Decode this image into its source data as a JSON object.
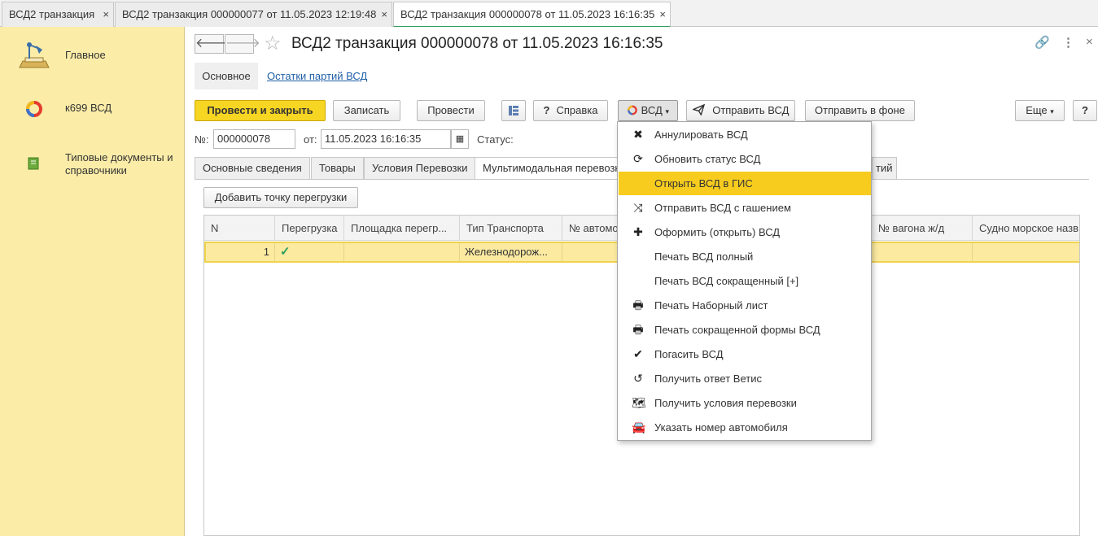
{
  "window_tabs": [
    {
      "label": "ВСД2 транзакция",
      "close": "×"
    },
    {
      "label": "ВСД2 транзакция 000000077 от 11.05.2023 12:19:48",
      "close": "×"
    },
    {
      "label": "ВСД2 транзакция 000000078 от 11.05.2023 16:16:35",
      "close": "×"
    }
  ],
  "sidebar": {
    "items": [
      {
        "label": "Главное",
        "icon": "desk-lamp-icon"
      },
      {
        "label": "к699 ВСД",
        "icon": "vetis-logo-icon"
      },
      {
        "label": "Типовые документы и справочники",
        "icon": "green-book-icon"
      }
    ]
  },
  "header": {
    "title": "ВСД2 транзакция 000000078 от 11.05.2023 16:16:35",
    "back": "🡐",
    "forward": "🡒",
    "link_icon": "🔗",
    "more_icon": "⋮",
    "close_icon": "×"
  },
  "subnav": {
    "main": "Основное",
    "link": "Остатки партий ВСД"
  },
  "toolbar": {
    "post_close": "Провести и закрыть",
    "save": "Записать",
    "post": "Провести",
    "help": "Справка",
    "vsd": "ВСД",
    "send_vsd": "Отправить ВСД",
    "send_bg": "Отправить в фоне",
    "more": "Еще",
    "question": "?"
  },
  "fields": {
    "number_label": "№:",
    "number_value": "000000078",
    "date_label": "от:",
    "date_value": "11.05.2023 16:16:35",
    "status_label": "Статус:"
  },
  "form_tabs": [
    "Основные сведения",
    "Товары",
    "Условия Перевозки",
    "Мультимодальная перевозка",
    "тий"
  ],
  "grid": {
    "add_button": "Добавить точку перегрузки",
    "columns": [
      "N",
      "Перегрузка",
      "Площадка перегр...",
      "Тип Транспорта",
      "№ автомо",
      "№ вагона ж/д",
      "Судно морское назв"
    ],
    "rows": [
      {
        "n": "1",
        "reload": "✓",
        "site": "",
        "transport": "Железнодорож...",
        "auto": "",
        "wagon": "",
        "ship": ""
      }
    ]
  },
  "vsd_menu": [
    {
      "label": "Аннулировать ВСД",
      "icon": "✖"
    },
    {
      "label": "Обновить статус ВСД",
      "icon": "⟳"
    },
    {
      "label": "Открыть ВСД в ГИС",
      "icon": ""
    },
    {
      "label": "Отправить ВСД с гашением",
      "icon": "⤨"
    },
    {
      "label": "Оформить (открыть) ВСД",
      "icon": "✚"
    },
    {
      "label": "Печать ВСД полный",
      "icon": ""
    },
    {
      "label": "Печать ВСД сокращенный [+]",
      "icon": ""
    },
    {
      "label": "Печать Наборный лист",
      "icon": "🖶"
    },
    {
      "label": "Печать сокращенной формы ВСД",
      "icon": "🖶"
    },
    {
      "label": "Погасить ВСД",
      "icon": "✔"
    },
    {
      "label": "Получить ответ Ветис",
      "icon": "↺"
    },
    {
      "label": "Получить условия перевозки",
      "icon": "🗺"
    },
    {
      "label": "Указать номер автомобиля",
      "icon": "🚘"
    }
  ],
  "colors": {
    "accent_yellow": "#f7d523",
    "sidebar": "#fbeda8",
    "highlight": "#f7cc1f",
    "link": "#2060a8",
    "check": "#2e9e5b"
  }
}
